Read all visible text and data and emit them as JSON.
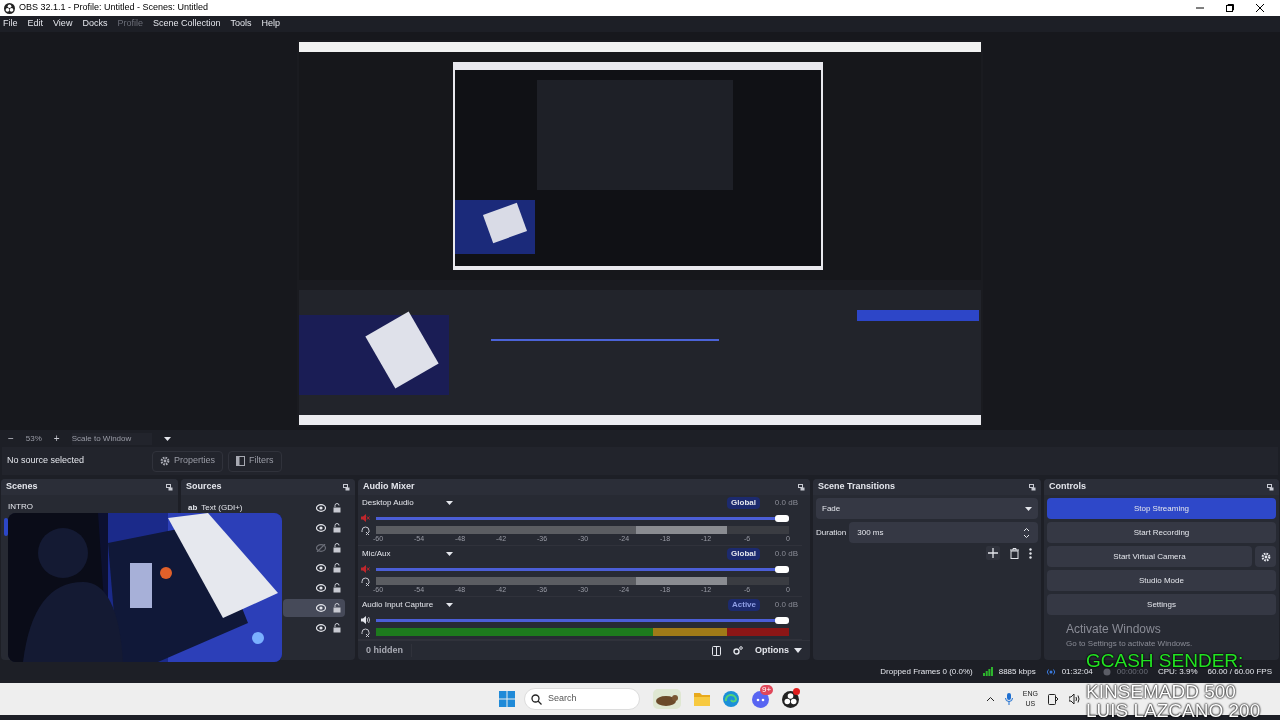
{
  "window": {
    "title": "OBS 32.1.1 - Profile: Untitled - Scenes: Untitled"
  },
  "menu": [
    {
      "label": "File",
      "disabled": false
    },
    {
      "label": "Edit",
      "disabled": false
    },
    {
      "label": "View",
      "disabled": false
    },
    {
      "label": "Docks",
      "disabled": false
    },
    {
      "label": "Profile",
      "disabled": true
    },
    {
      "label": "Scene Collection",
      "disabled": false
    },
    {
      "label": "Tools",
      "disabled": false
    },
    {
      "label": "Help",
      "disabled": false
    }
  ],
  "zoom_bar": {
    "zoom_out": "−",
    "zoom": "53%",
    "zoom_in": "+",
    "scale_mode": "Scale to Window"
  },
  "source_toolbar": {
    "status": "No source selected",
    "buttons": [
      {
        "label": "Properties",
        "kind": "properties"
      },
      {
        "label": "Filters",
        "kind": "filters"
      }
    ]
  },
  "scenes": {
    "title": "Scenes",
    "items": [
      {
        "label": "INTRO",
        "selected": false
      },
      {
        "selected": true
      }
    ]
  },
  "sources": {
    "title": "Sources",
    "items": [
      {
        "icon_text": "ab",
        "label": "Text (GDI+)",
        "visible": true,
        "selected": false
      },
      {
        "visible": true,
        "selected": false
      },
      {
        "visible": false,
        "selected": false
      },
      {
        "visible": true,
        "selected": false
      },
      {
        "visible": true,
        "selected": false
      },
      {
        "visible": true,
        "selected": true
      },
      {
        "visible": true,
        "selected": false
      }
    ]
  },
  "audio_mixer": {
    "title": "Audio Mixer",
    "channels": [
      {
        "name": "Desktop Audio",
        "badge": "Global",
        "reading": "0.0 dB",
        "muted": true,
        "volume": {
          "level": 1
        },
        "meter": {
          "level": 0.85
        },
        "scale": [
          "-60",
          "-54",
          "-48",
          "-42",
          "-36",
          "-30",
          "-24",
          "-18",
          "-12",
          "-6",
          "0"
        ]
      },
      {
        "name": "Mic/Aux",
        "badge": "Global",
        "reading": "0.0 dB",
        "muted": true,
        "volume": {
          "level": 1
        },
        "meter": {
          "level": 0.85
        },
        "scale": [
          "-60",
          "-54",
          "-48",
          "-42",
          "-36",
          "-30",
          "-24",
          "-18",
          "-12",
          "-6",
          "0"
        ]
      },
      {
        "name": "Audio Input Capture",
        "badge": "Active",
        "reading": "0.0 dB",
        "muted": false,
        "volume": {
          "level": 1
        },
        "meter": {
          "level": 1
        }
      }
    ],
    "hidden_count": "0 hidden",
    "options": "Options"
  },
  "scene_transitions": {
    "title": "Scene Transitions",
    "transition": "Fade",
    "duration_label": "Duration",
    "duration": "300 ms"
  },
  "controls": {
    "title": "Controls",
    "buttons": [
      {
        "label": "Stop Streaming",
        "active": true,
        "kind": "plain"
      },
      {
        "label": "Start Recording",
        "active": false,
        "kind": "plain"
      },
      {
        "label": "Start Virtual Camera",
        "active": false,
        "kind": "with_settings"
      },
      {
        "label": "Studio Mode",
        "active": false,
        "kind": "plain"
      },
      {
        "label": "Settings",
        "active": false,
        "kind": "plain"
      }
    ]
  },
  "activation_notice": {
    "title": "Activate Windows",
    "subtitle": "Go to Settings to activate Windows."
  },
  "status_bar": {
    "dropped_frames": "Dropped Frames 0 (0.0%)",
    "bitrate": "8885 kbps",
    "stream_time": "01:32:04",
    "record_time": "00:00:00",
    "cpu": "CPU: 3.9%",
    "fps": "60.00 / 60.00 FPS"
  },
  "overlay_text": [
    {
      "text": "GCASH SENDER:",
      "color": "#22e322"
    },
    {
      "text": "KINSEMADD 500",
      "color": "#ffffff"
    },
    {
      "text": "LUIS LAZCANO 200",
      "color": "#ffffff"
    }
  ],
  "taskbar": {
    "search_placeholder": "Search",
    "apps": [
      {
        "kind": "widget"
      },
      {
        "kind": "folder"
      },
      {
        "kind": "browser"
      },
      {
        "kind": "chat",
        "badge": "9+"
      },
      {
        "kind": "obs",
        "notification": true
      }
    ],
    "language": "ENG",
    "region": "US"
  }
}
